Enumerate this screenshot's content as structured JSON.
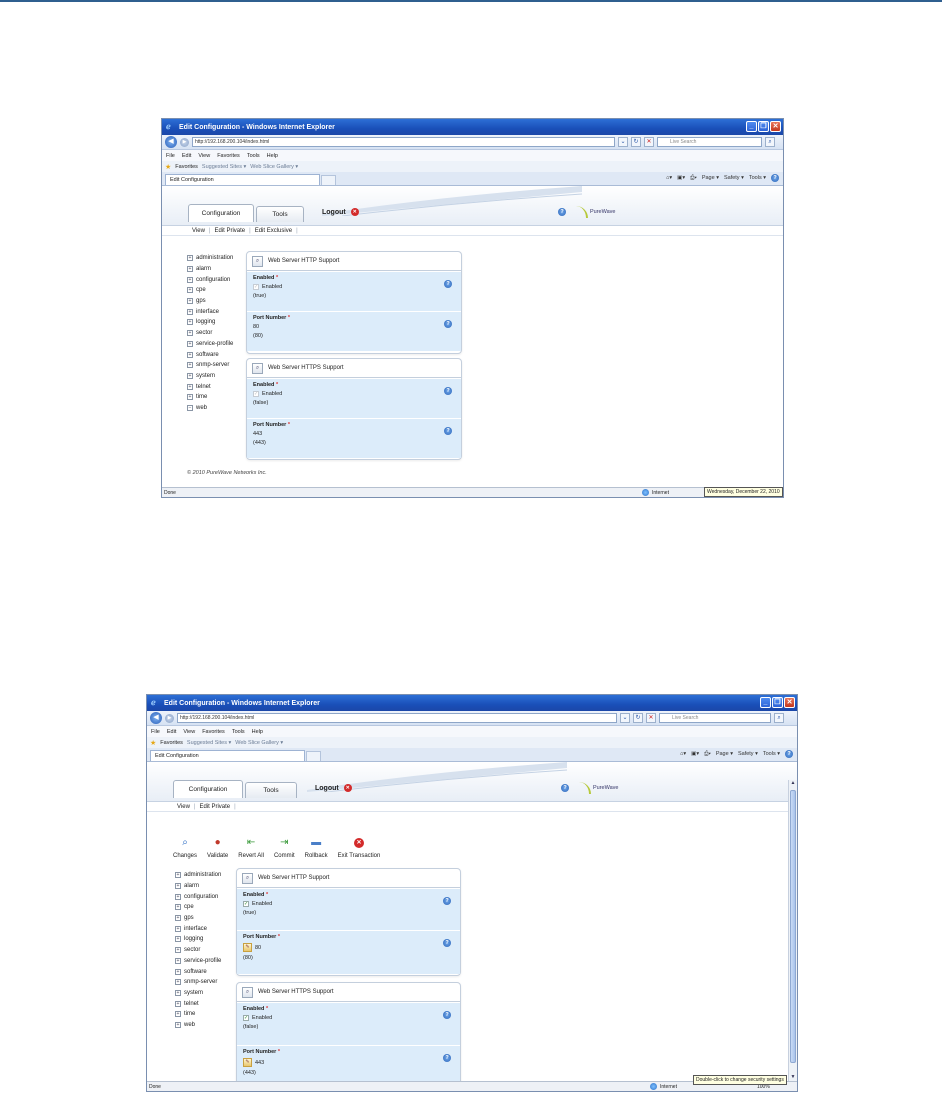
{
  "browser": {
    "window_title": "Edit Configuration - Windows Internet Explorer",
    "url": "http://192.168.200.104/index.html",
    "search_placeholder": "Live Search",
    "menu": [
      "File",
      "Edit",
      "View",
      "Favorites",
      "Tools",
      "Help"
    ],
    "favorites_label": "Favorites",
    "suggested_sites": "Suggested Sites ▾",
    "web_slice_gallery": "Web Slice Gallery ▾",
    "tab_title": "Edit Configuration",
    "cmd": {
      "page": "Page ▾",
      "safety": "Safety ▾",
      "tools": "Tools ▾"
    },
    "status_done": "Done",
    "zone": "Internet"
  },
  "app": {
    "tabs": [
      "Configuration",
      "Tools"
    ],
    "logout": "Logout",
    "brand": "PureWave",
    "footer": "© 2010 PureWave Networks Inc.",
    "tree": [
      "administration",
      "alarm",
      "configuration",
      "cpe",
      "gps",
      "interface",
      "logging",
      "sector",
      "service-profile",
      "software",
      "snmp-server",
      "system",
      "telnet",
      "time",
      "web"
    ],
    "http": {
      "title": "Web Server HTTP Support",
      "enabled_label": "Enabled",
      "enabled_check": "Enabled",
      "enabled_default": "(true)",
      "port_label": "Port Number",
      "port_value": "80",
      "port_default": "(80)"
    },
    "https": {
      "title": "Web Server HTTPS Support",
      "enabled_label": "Enabled",
      "enabled_check": "Enabled",
      "enabled_default": "(false)",
      "port_label": "Port Number",
      "port_value": "443",
      "port_default": "(443)"
    }
  },
  "shot1": {
    "subnav": [
      "View",
      "Edit Private",
      "Edit Exclusive"
    ],
    "status_date": "Wednesday, December 22, 2010"
  },
  "shot2": {
    "subnav": [
      "View",
      "Edit Private"
    ],
    "actions": [
      {
        "label": "Changes",
        "icon": "magnifier-icon",
        "glyph": "🔍",
        "color": "#2b6cc4"
      },
      {
        "label": "Validate",
        "icon": "validate-icon",
        "glyph": "●",
        "color": "#c0392b"
      },
      {
        "label": "Revert All",
        "icon": "revert-all-icon",
        "glyph": "⇤",
        "color": "#3a9a3a"
      },
      {
        "label": "Commit",
        "icon": "commit-icon",
        "glyph": "⇥",
        "color": "#3a9a3a"
      },
      {
        "label": "Rollback",
        "icon": "rollback-icon",
        "glyph": "▬",
        "color": "#4a7fc8"
      },
      {
        "label": "Exit Transaction",
        "icon": "exit-transaction-icon",
        "glyph": "✕",
        "color": "#d32b2b"
      }
    ],
    "tooltip": "Double-click to change security settings",
    "zoom": "100%"
  }
}
